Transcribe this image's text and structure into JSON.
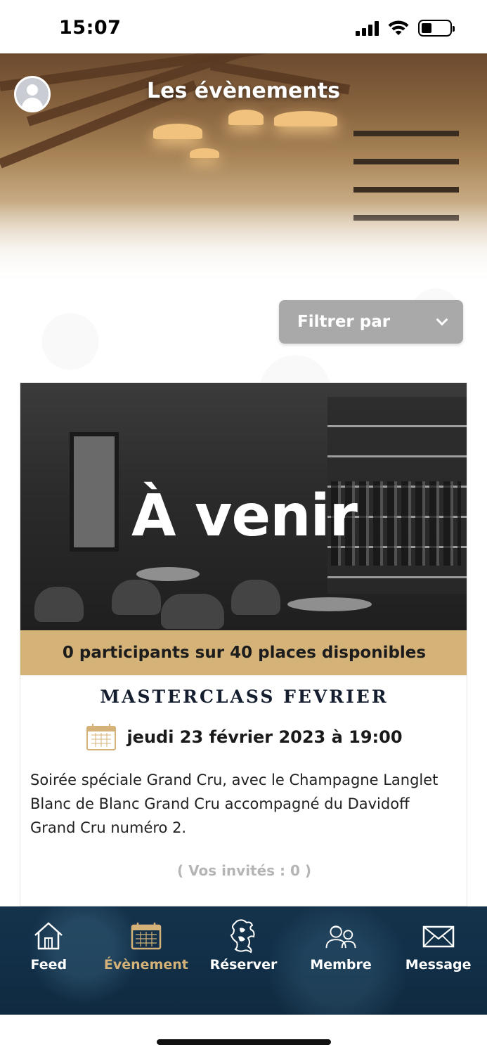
{
  "status_bar": {
    "time": "15:07"
  },
  "header": {
    "title": "Les évènements"
  },
  "filter": {
    "label": "Filtrer par"
  },
  "event": {
    "overlay_title": "À venir",
    "participants": "0  participants sur  40  places disponibles",
    "title": "MASTERCLASS FEVRIER",
    "date": "jeudi 23 février 2023 à 19:00",
    "description": "Soirée spéciale Grand Cru, avec le Champagne Langlet Blanc de Blanc Grand Cru accompagné du Davidoff Grand Cru numéro 2.",
    "guests": "( Vos invités :  0 )"
  },
  "bottom_nav": {
    "items": [
      {
        "label": "Feed",
        "icon": "house-icon"
      },
      {
        "label": "Évènement",
        "icon": "calendar-icon"
      },
      {
        "label": "Réserver",
        "icon": "lion-crest-icon"
      },
      {
        "label": "Membre",
        "icon": "members-icon"
      },
      {
        "label": "Message",
        "icon": "envelope-icon"
      }
    ],
    "active": "Évènement"
  },
  "colors": {
    "gold": "#d4b278",
    "navy": "#123049",
    "filter_bg": "#a9a9a9"
  }
}
